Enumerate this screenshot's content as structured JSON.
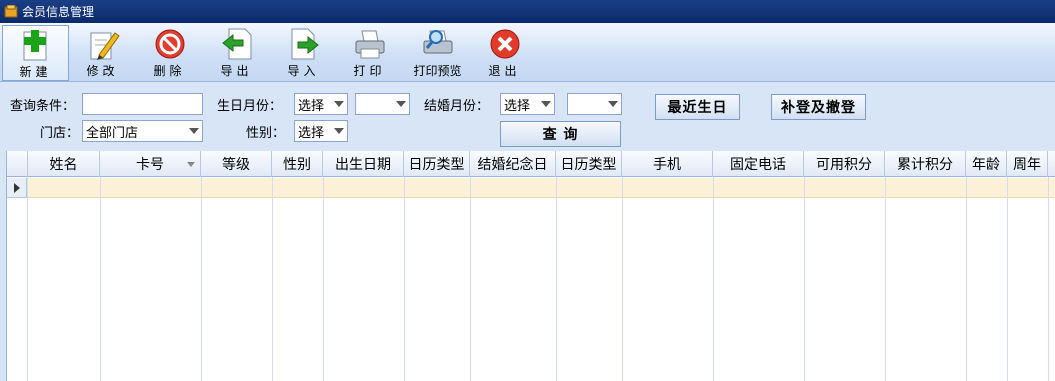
{
  "window": {
    "title": "会员信息管理"
  },
  "toolbar": {
    "buttons": [
      {
        "label": "新建",
        "icon": "plus-icon"
      },
      {
        "label": "修改",
        "icon": "edit-icon"
      },
      {
        "label": "删除",
        "icon": "delete-icon"
      },
      {
        "label": "导出",
        "icon": "export-icon"
      },
      {
        "label": "导入",
        "icon": "import-icon"
      },
      {
        "label": "打印",
        "icon": "printer-icon"
      },
      {
        "label": "打印预览",
        "icon": "print-preview-icon"
      },
      {
        "label": "退出",
        "icon": "exit-icon"
      }
    ]
  },
  "filter": {
    "query_label": "查询条件：",
    "query_value": "",
    "store_label": "门店：",
    "store_value": "全部门店",
    "birthday_month_label": "生日月份：",
    "birthday_month_select": "选择",
    "birthday_month_value": "",
    "gender_label": "性别：",
    "gender_select": "选择",
    "wedding_month_label": "结婚月份：",
    "wedding_month_select": "选择",
    "wedding_month_value": "",
    "recent_birthday_button": "最近生日",
    "makeup_button": "补登及撤登",
    "search_button": "查 询"
  },
  "table": {
    "columns": [
      "姓名",
      "卡号",
      "等级",
      "性别",
      "出生日期",
      "日历类型",
      "结婚纪念日",
      "日历类型",
      "手机",
      "固定电话",
      "可用积分",
      "累计积分",
      "年龄",
      "周年"
    ]
  },
  "colors": {
    "title_bar": "#0b2a6b",
    "selected_row": "#fcf1d6",
    "background": "#d7e5f7"
  }
}
